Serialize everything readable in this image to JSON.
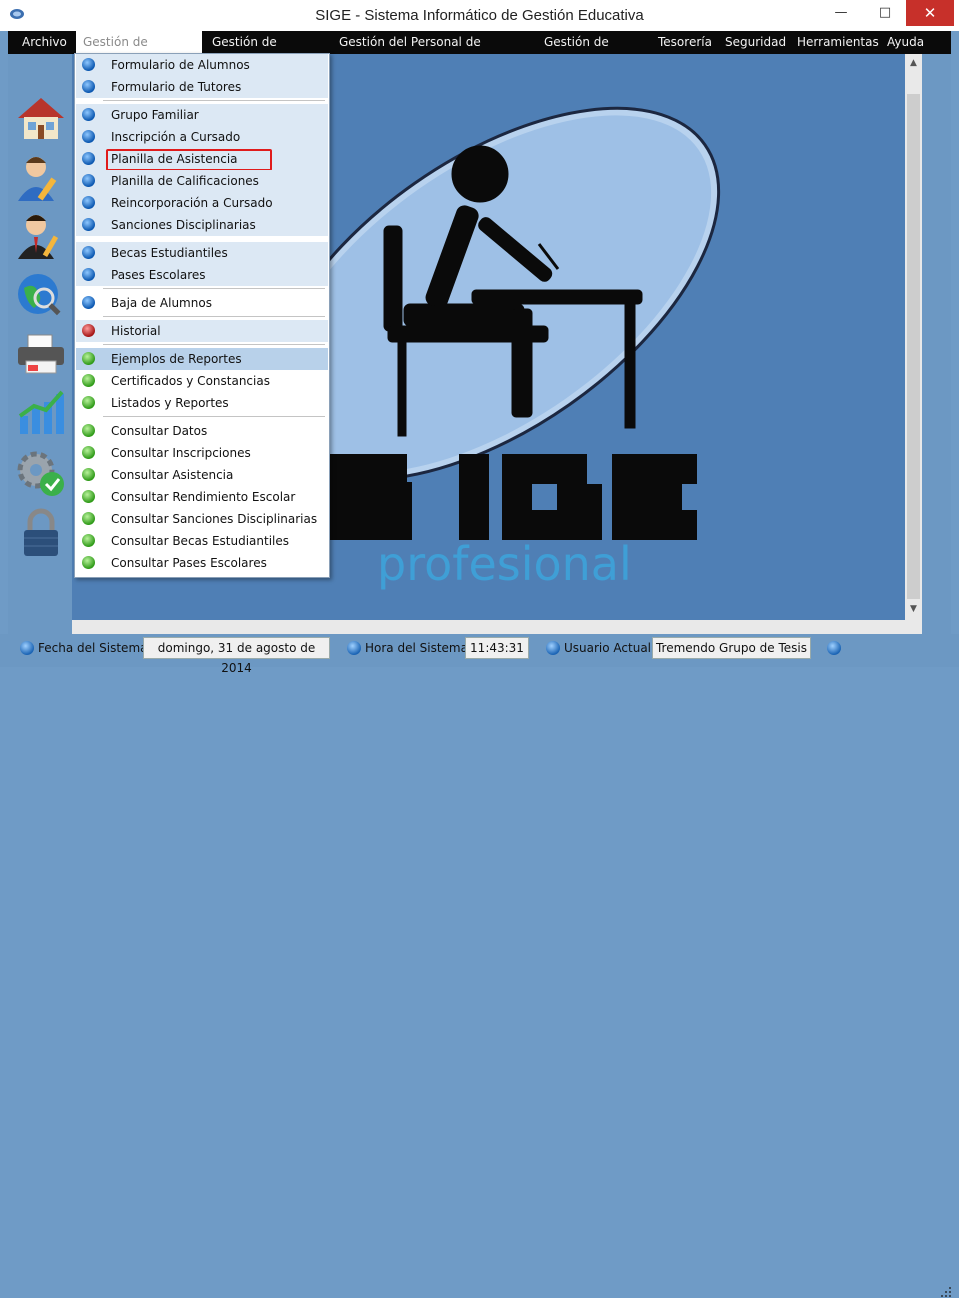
{
  "window": {
    "title": "SIGE - Sistema Informático de Gestión Educativa",
    "min_glyph": "—",
    "max_glyph": "□",
    "close_glyph": "✕"
  },
  "menubar": [
    {
      "label": "Archivo",
      "active": false
    },
    {
      "label": "Gestión de Alumnos",
      "active": true
    },
    {
      "label": "Gestión de Docentes",
      "active": false
    },
    {
      "label": "Gestión del Personal de Maestranza",
      "active": false
    },
    {
      "label": "Gestión de Cursos",
      "active": false
    },
    {
      "label": "Tesorería",
      "active": false
    },
    {
      "label": "Seguridad",
      "active": false
    },
    {
      "label": "Herramientas",
      "active": false
    },
    {
      "label": "Ayuda",
      "active": false
    }
  ],
  "toolbar": [
    {
      "icon": "house-icon"
    },
    {
      "icon": "user-edit-icon"
    },
    {
      "icon": "teacher-icon"
    },
    {
      "icon": "globe-search-icon"
    },
    {
      "icon": "printer-icon"
    },
    {
      "icon": "bar-chart-icon"
    },
    {
      "icon": "gear-check-icon"
    },
    {
      "icon": "padlock-icon"
    }
  ],
  "dropdown": {
    "items": [
      {
        "label": "Formulario de Alumnos",
        "dot": "blue",
        "group": true
      },
      {
        "label": "Formulario de Tutores",
        "dot": "blue",
        "group": true
      },
      {
        "label": "Grupo Familiar",
        "dot": "blue",
        "group": true
      },
      {
        "label": "Inscripción a Cursado",
        "dot": "blue",
        "group": true
      },
      {
        "label": "Planilla de Asistencia",
        "dot": "blue",
        "group": true,
        "highlighted_box": true
      },
      {
        "label": "Planilla de Calificaciones",
        "dot": "blue",
        "group": true
      },
      {
        "label": "Reincorporación a Cursado",
        "dot": "blue",
        "group": true
      },
      {
        "label": "Sanciones Disciplinarias",
        "dot": "blue",
        "group": true
      },
      {
        "label": "Becas Estudiantiles",
        "dot": "blue",
        "group": true
      },
      {
        "label": "Pases Escolares",
        "dot": "blue",
        "group": true
      },
      {
        "label": "Baja de Alumnos",
        "dot": "blue",
        "group": false
      },
      {
        "label": "Historial",
        "dot": "red",
        "group": true
      },
      {
        "label": "Ejemplos de Reportes",
        "dot": "green",
        "group": true,
        "hover": true
      },
      {
        "label": "Certificados y Constancias",
        "dot": "green",
        "group": false
      },
      {
        "label": "Listados y Reportes",
        "dot": "green",
        "group": false
      },
      {
        "label": "Consultar Datos",
        "dot": "green",
        "group": false
      },
      {
        "label": "Consultar Inscripciones",
        "dot": "green",
        "group": false
      },
      {
        "label": "Consultar Asistencia",
        "dot": "green",
        "group": false
      },
      {
        "label": "Consultar Rendimiento Escolar",
        "dot": "green",
        "group": false
      },
      {
        "label": "Consultar Sanciones Disciplinarias",
        "dot": "green",
        "group": false
      },
      {
        "label": "Consultar Becas Estudiantiles",
        "dot": "green",
        "group": false
      },
      {
        "label": "Consultar Pases Escolares",
        "dot": "green",
        "group": false
      }
    ]
  },
  "logo": {
    "word": "SIGE",
    "subtitle": "profesional"
  },
  "statusbar": {
    "fecha_label": "Fecha del Sistema",
    "fecha_value": "domingo, 31 de agosto de 2014",
    "hora_label": "Hora del Sistema",
    "hora_value": "11:43:31",
    "usuario_label": "Usuario Actual",
    "usuario_value": "Tremendo Grupo de Tesis"
  },
  "colors": {
    "menubar_bg": "#0a0a0a",
    "main_bg": "#4f7fb5",
    "frame_bg": "#6c98c3",
    "close_button": "#c7302a",
    "logo_subtitle": "#3f9fd6"
  }
}
